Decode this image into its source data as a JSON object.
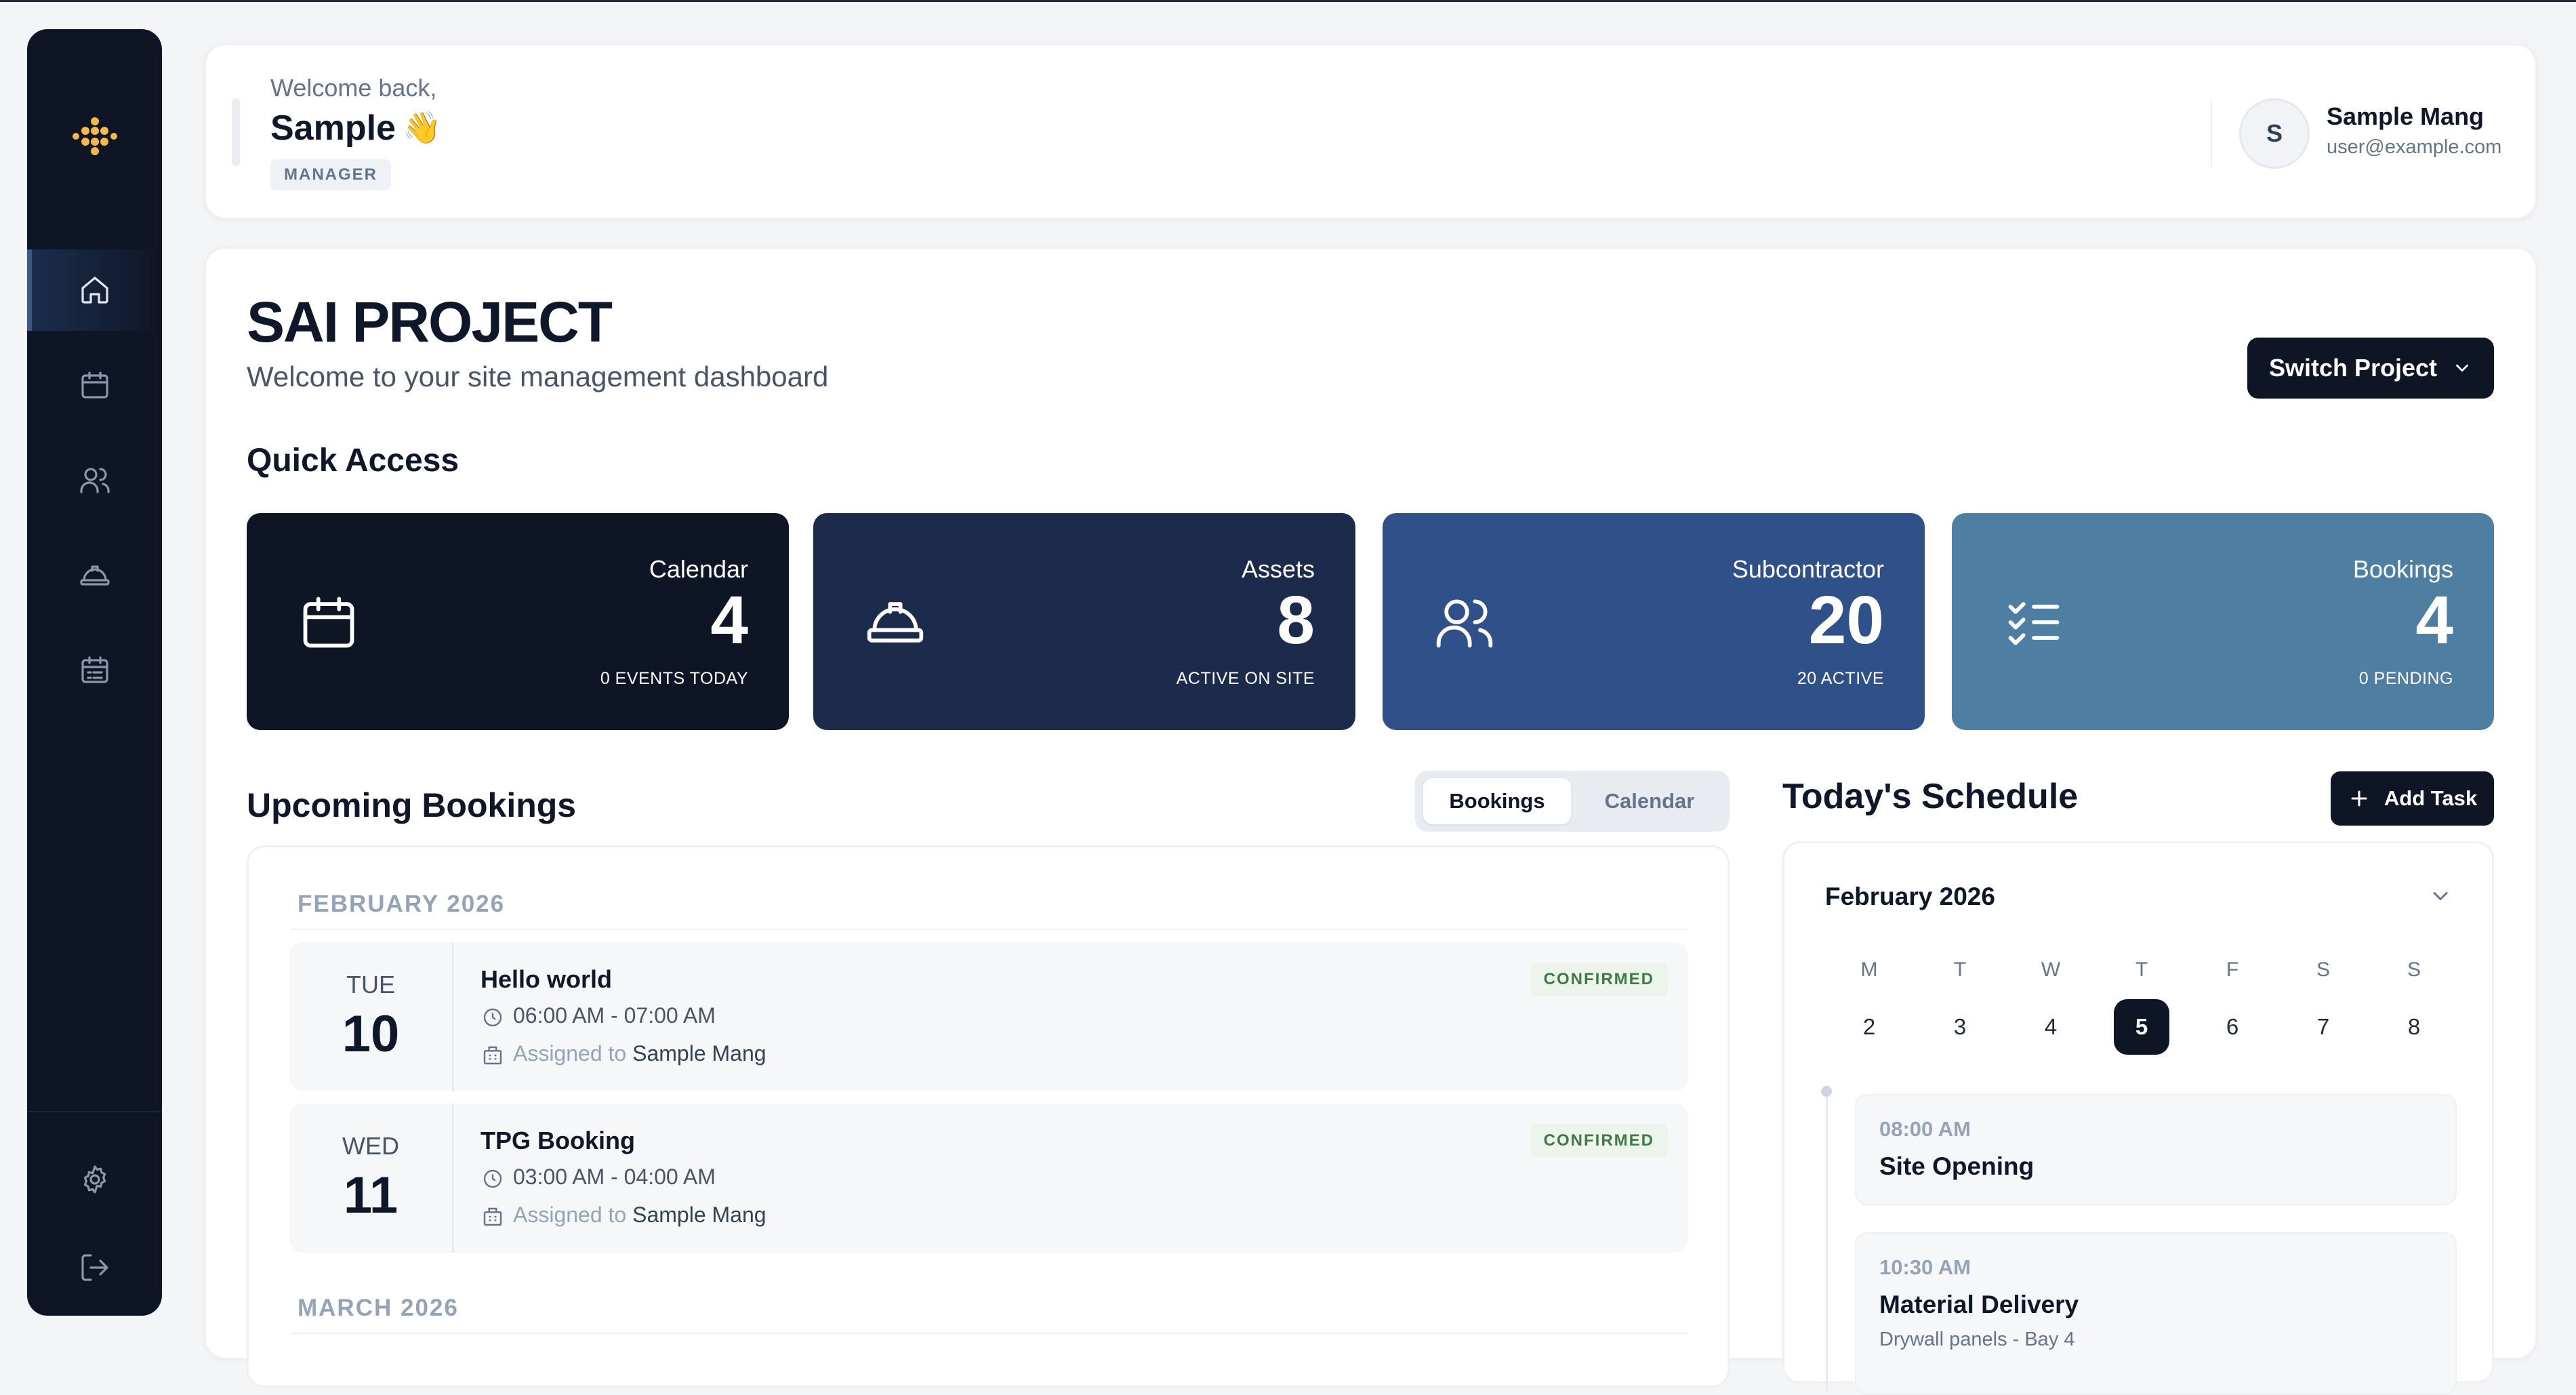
{
  "header": {
    "welcome": "Welcome back,",
    "name": "Sample",
    "wave": "👋",
    "role": "MANAGER",
    "avatar_initial": "S",
    "user_name": "Sample Mang",
    "user_email": "user@example.com"
  },
  "sidebar": {
    "items": [
      {
        "icon": "home-icon",
        "active": true
      },
      {
        "icon": "calendar-icon",
        "active": false
      },
      {
        "icon": "users-icon",
        "active": false
      },
      {
        "icon": "hard-hat-icon",
        "active": false
      },
      {
        "icon": "calendar-list-icon",
        "active": false
      }
    ],
    "bottom": [
      {
        "icon": "gear-icon"
      },
      {
        "icon": "logout-icon"
      }
    ]
  },
  "project": {
    "title": "SAI PROJECT",
    "subtitle": "Welcome to your site management dashboard",
    "switch_label": "Switch Project"
  },
  "quick_access": {
    "title": "Quick Access",
    "cards": [
      {
        "label": "Calendar",
        "value": "4",
        "sub": "0 EVENTS TODAY",
        "color": "#0e1525",
        "icon": "calendar-icon"
      },
      {
        "label": "Assets",
        "value": "8",
        "sub": "ACTIVE ON SITE",
        "color": "#1c2a4b",
        "icon": "hard-hat-icon"
      },
      {
        "label": "Subcontractor",
        "value": "20",
        "sub": "20 ACTIVE",
        "color": "#2f5088",
        "icon": "users-icon"
      },
      {
        "label": "Bookings",
        "value": "4",
        "sub": "0 PENDING",
        "color": "#4e7fa2",
        "icon": "checklist-icon"
      }
    ]
  },
  "bookings": {
    "title": "Upcoming Bookings",
    "tabs": [
      "Bookings",
      "Calendar"
    ],
    "months": [
      {
        "label": "FEBRUARY 2026",
        "items": [
          {
            "dow": "TUE",
            "day": "10",
            "name": "Hello world",
            "time": "06:00 AM - 07:00 AM",
            "assigned_prefix": "Assigned to",
            "assignee": "Sample Mang",
            "status": "CONFIRMED"
          },
          {
            "dow": "WED",
            "day": "11",
            "name": "TPG Booking",
            "time": "03:00 AM - 04:00 AM",
            "assigned_prefix": "Assigned to",
            "assignee": "Sample Mang",
            "status": "CONFIRMED"
          }
        ]
      },
      {
        "label": "MARCH 2026",
        "items": []
      }
    ]
  },
  "schedule": {
    "title": "Today's Schedule",
    "add_label": "Add Task",
    "month": "February 2026",
    "weekdays": [
      "M",
      "T",
      "W",
      "T",
      "F",
      "S",
      "S"
    ],
    "days": [
      "2",
      "3",
      "4",
      "5",
      "6",
      "7",
      "8"
    ],
    "selected_day": "5",
    "tasks": [
      {
        "time": "08:00 AM",
        "name": "Site Opening",
        "desc": ""
      },
      {
        "time": "10:30 AM",
        "name": "Material Delivery",
        "desc": "Drywall panels - Bay 4"
      }
    ]
  }
}
